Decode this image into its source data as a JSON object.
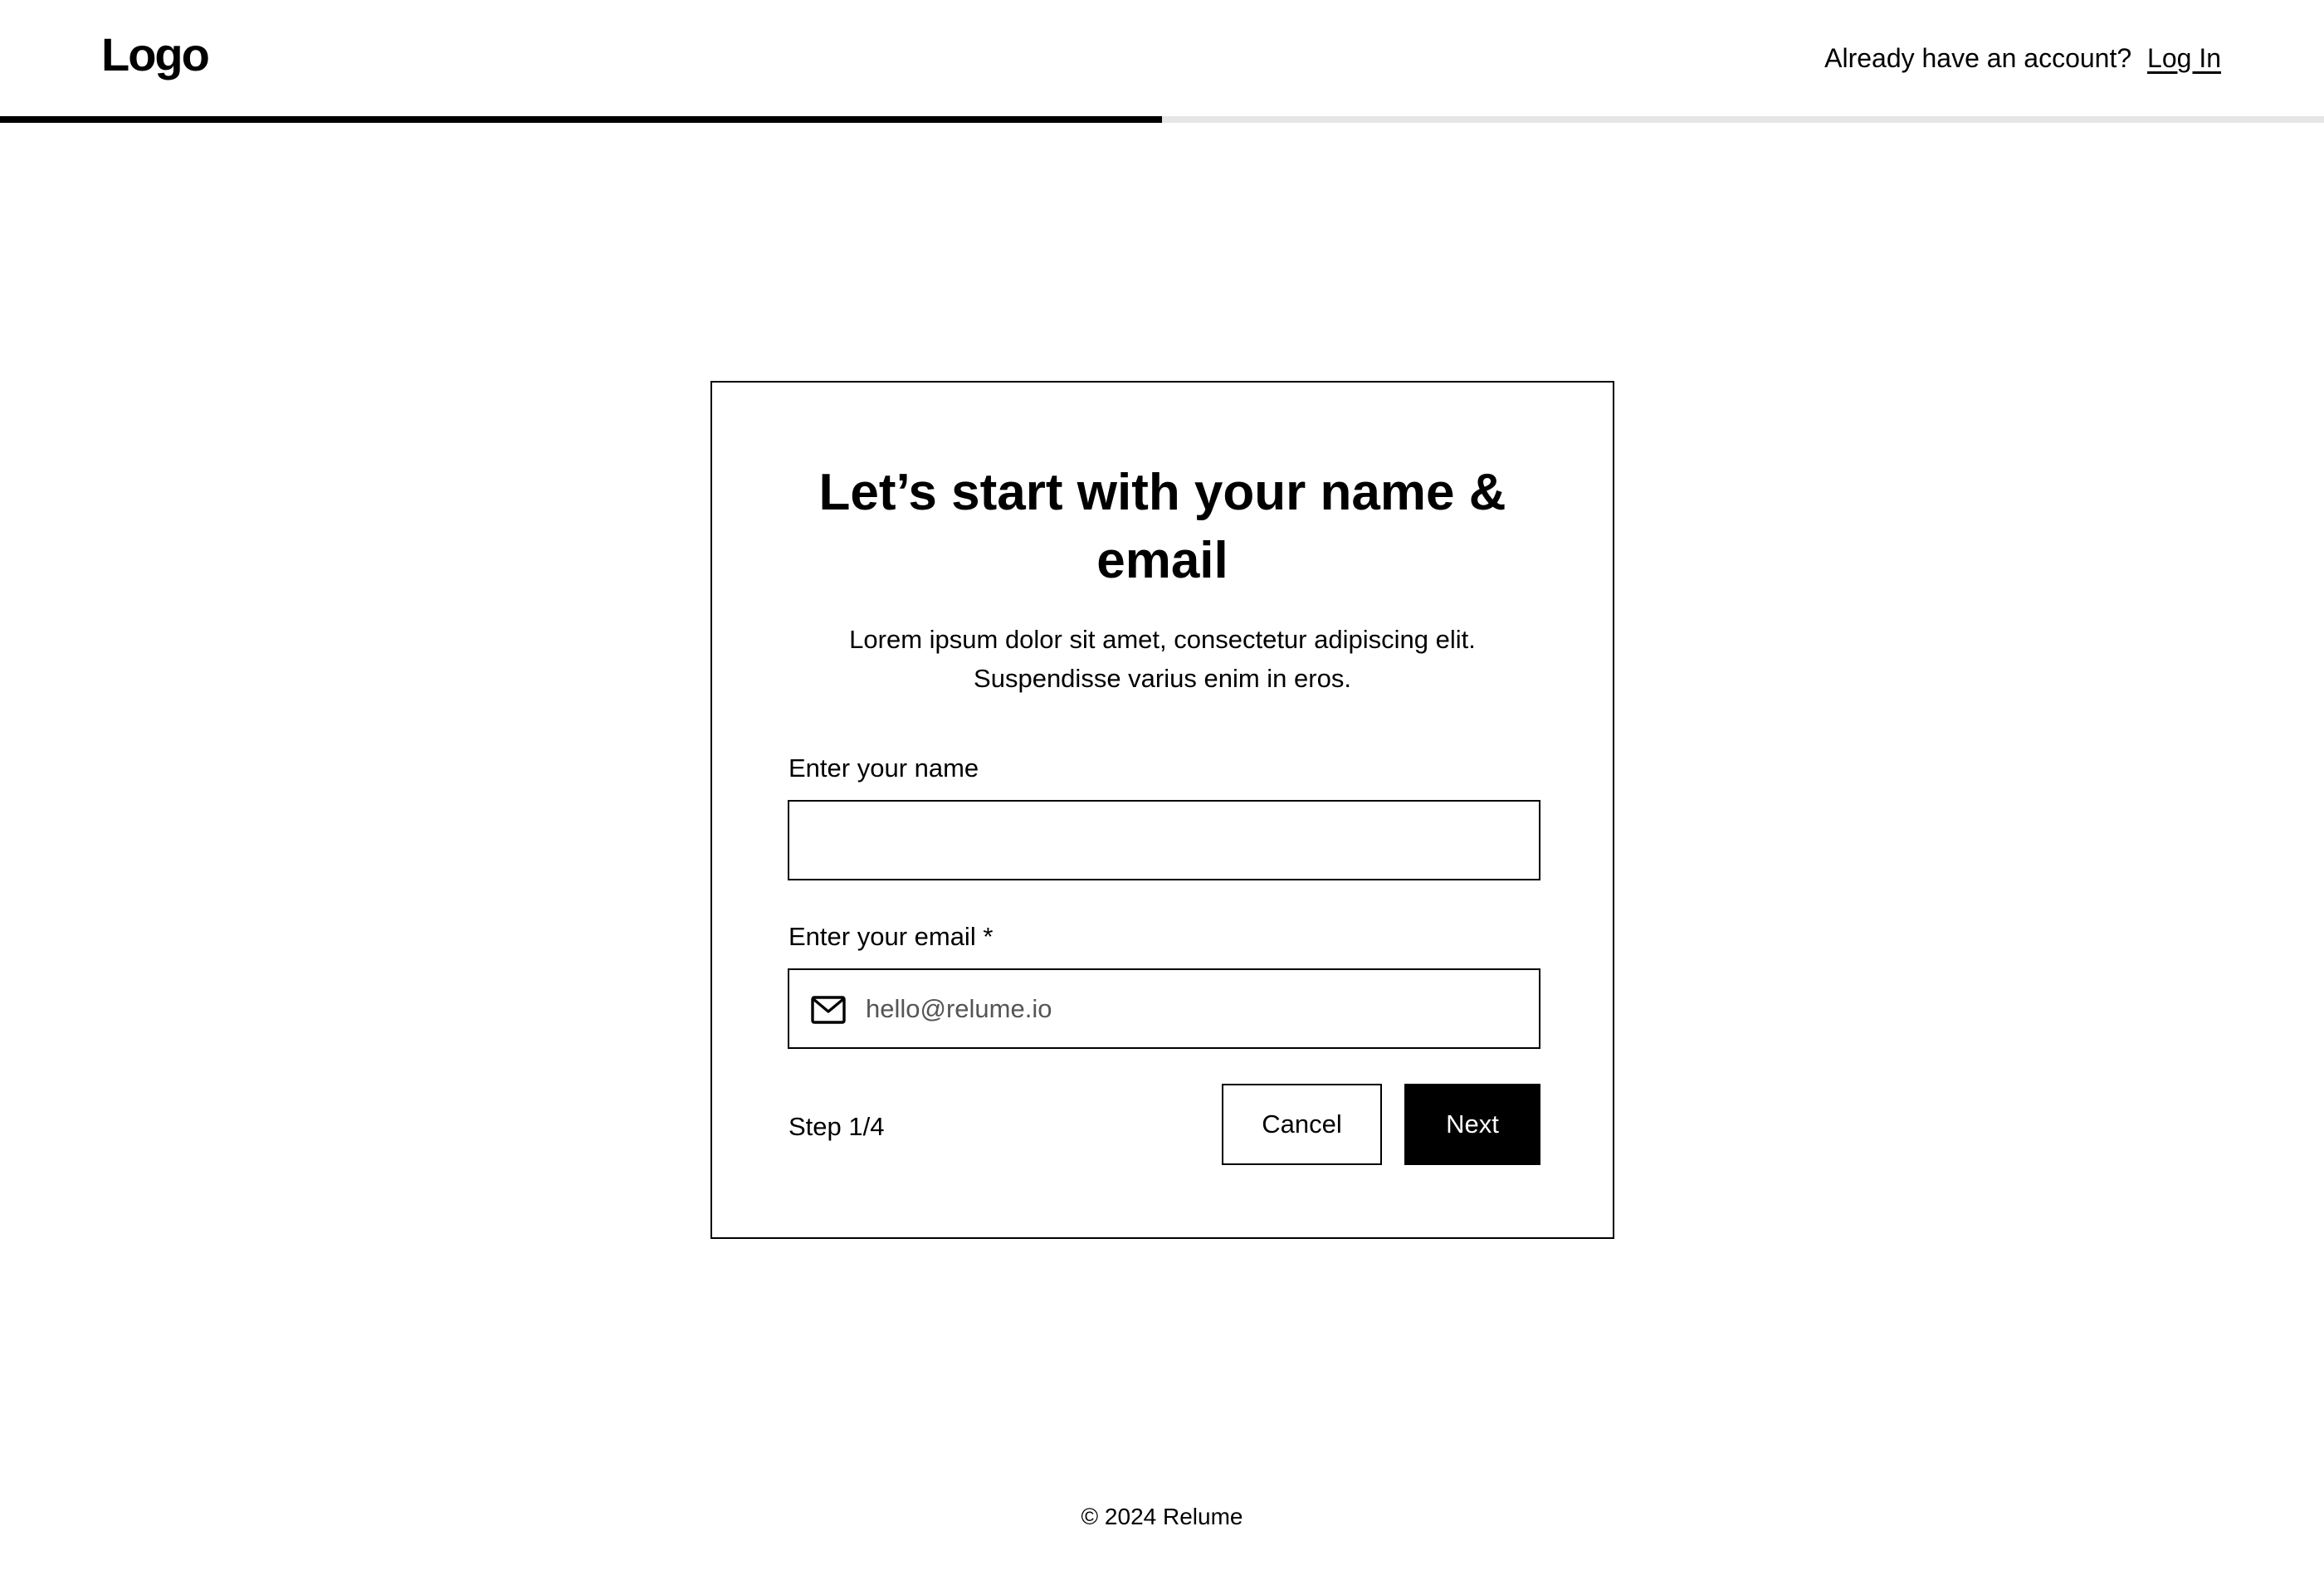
{
  "header": {
    "logo_text": "Logo",
    "login_prompt": "Already have an account?",
    "login_link": "Log In"
  },
  "progress": {
    "fraction": 0.5
  },
  "card": {
    "title": "Let’s start with your name & email",
    "subtitle": "Lorem ipsum dolor sit amet, consectetur adipiscing elit. Suspendisse varius enim in eros.",
    "name_label": "Enter your name",
    "name_value": "",
    "name_placeholder": "",
    "email_label": "Enter your email *",
    "email_value": "",
    "email_placeholder": "hello@relume.io",
    "email_icon": "mail-icon",
    "step_text": "Step 1/4",
    "cancel_label": "Cancel",
    "next_label": "Next"
  },
  "footer": {
    "copyright": "© 2024 Relume"
  },
  "colors": {
    "primary": "#000000",
    "background": "#ffffff",
    "progress_track": "#e6e6e6",
    "placeholder": "#555555"
  }
}
